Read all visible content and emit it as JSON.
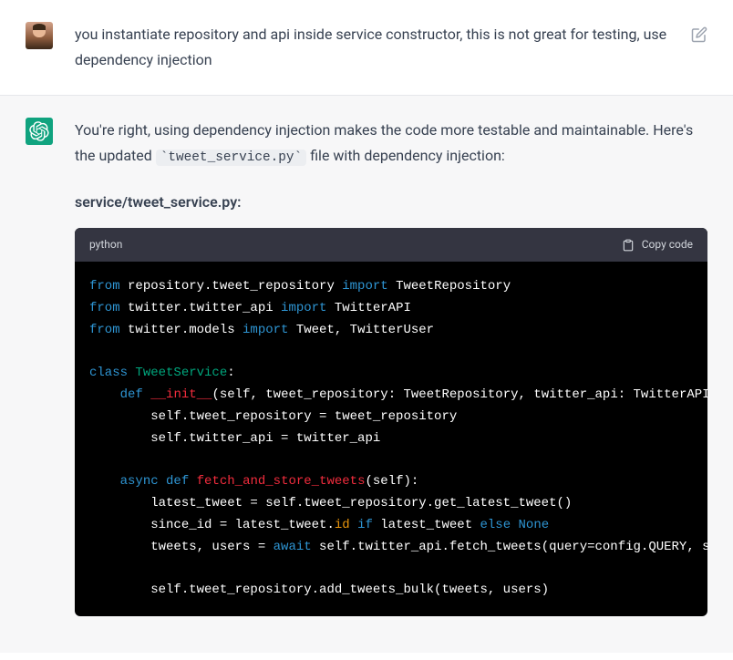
{
  "user_message": {
    "text": "you instantiate repository and api inside service constructor, this is not great for testing, use dependency injection"
  },
  "assistant_message": {
    "intro_part1": "You're right, using dependency injection makes the code more testable and maintainable. Here's the updated ",
    "inline_code": "tweet_service.py",
    "intro_part2": " file with dependency injection:",
    "file_label": "service/tweet_service.py:"
  },
  "code_block": {
    "language": "python",
    "copy_label": "Copy code",
    "tokens": [
      [
        [
          "kw",
          "from"
        ],
        [
          "id",
          " repository.tweet_repository "
        ],
        [
          "kw",
          "import"
        ],
        [
          "id",
          " TweetRepository"
        ]
      ],
      [
        [
          "kw",
          "from"
        ],
        [
          "id",
          " twitter.twitter_api "
        ],
        [
          "kw",
          "import"
        ],
        [
          "id",
          " TwitterAPI"
        ]
      ],
      [
        [
          "kw",
          "from"
        ],
        [
          "id",
          " twitter.models "
        ],
        [
          "kw",
          "import"
        ],
        [
          "id",
          " Tweet, TwitterUser"
        ]
      ],
      [],
      [
        [
          "kw",
          "class"
        ],
        [
          "id",
          " "
        ],
        [
          "cls",
          "TweetService"
        ],
        [
          "punc",
          ":"
        ]
      ],
      [
        [
          "id",
          "    "
        ],
        [
          "kw",
          "def"
        ],
        [
          "id",
          " "
        ],
        [
          "def",
          "__init__"
        ],
        [
          "punc",
          "("
        ],
        [
          "id",
          "self, tweet_repository: TweetRepository, twitter_api: TwitterAPI"
        ],
        [
          "punc",
          "):"
        ]
      ],
      [
        [
          "id",
          "        self.tweet_repository = tweet_repository"
        ]
      ],
      [
        [
          "id",
          "        self.twitter_api = twitter_api"
        ]
      ],
      [],
      [
        [
          "id",
          "    "
        ],
        [
          "kw",
          "async"
        ],
        [
          "id",
          " "
        ],
        [
          "kw",
          "def"
        ],
        [
          "id",
          " "
        ],
        [
          "def",
          "fetch_and_store_tweets"
        ],
        [
          "punc",
          "("
        ],
        [
          "id",
          "self"
        ],
        [
          "punc",
          "):"
        ]
      ],
      [
        [
          "id",
          "        latest_tweet = self.tweet_repository.get_latest_tweet()"
        ]
      ],
      [
        [
          "id",
          "        since_id = latest_tweet."
        ],
        [
          "prop",
          "id"
        ],
        [
          "id",
          " "
        ],
        [
          "kw",
          "if"
        ],
        [
          "id",
          " latest_tweet "
        ],
        [
          "kw",
          "else"
        ],
        [
          "id",
          " "
        ],
        [
          "bool",
          "None"
        ]
      ],
      [
        [
          "id",
          "        tweets, users = "
        ],
        [
          "kw",
          "await"
        ],
        [
          "id",
          " self.twitter_api.fetch_tweets(query=config.QUERY, since_id=since_id)"
        ]
      ],
      [],
      [
        [
          "id",
          "        self.tweet_repository.add_tweets_bulk(tweets, users)"
        ]
      ]
    ]
  }
}
